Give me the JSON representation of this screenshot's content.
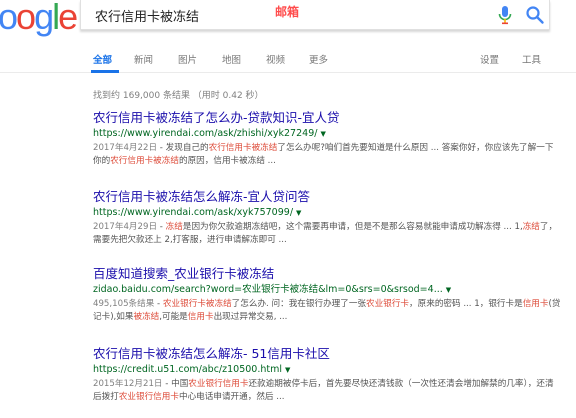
{
  "search": {
    "query": "农行信用卡被冻结",
    "annotation": "邮箱"
  },
  "logo": {
    "letters": [
      "o",
      "o",
      "g",
      "l",
      "e"
    ]
  },
  "tabs": [
    "全部",
    "新闻",
    "图片",
    "地图",
    "视频",
    "更多",
    "设置",
    "工具"
  ],
  "stats": "找到约 169,000 条结果 （用时 0.42 秒）",
  "results": [
    {
      "title": "农行信用卡被冻结了怎么办-贷款知识-宜人贷",
      "url": "https://www.yirendai.com/ask/zhishi/xyk27249/",
      "snippet": [
        {
          "t": "2017年4月22日",
          "c": "d"
        },
        {
          "t": " - 发现自己的"
        },
        {
          "t": "农行信用卡被冻结",
          "c": "hl"
        },
        {
          "t": "了怎么办呢?咱们首先要知道是什么原因 ... 答案你好，你应该先了解一下你的"
        },
        {
          "t": "农行信用卡被冻结",
          "c": "hl"
        },
        {
          "t": "的原因，信用卡被冻结 ..."
        }
      ]
    },
    {
      "title": "农行信用卡被冻结怎么解冻-宜人贷问答",
      "url": "https://www.yirendai.com/ask/xyk757099/",
      "snippet": [
        {
          "t": "2017年4月29日",
          "c": "d"
        },
        {
          "t": " - "
        },
        {
          "t": "冻结",
          "c": "hl"
        },
        {
          "t": "是因为你欠款逾期冻结吧，这个需要再申请，但是不是那么容易就能申请成功解冻得 ... 1,"
        },
        {
          "t": "冻结",
          "c": "hl"
        },
        {
          "t": "了，需要先把欠款还上 2,打客服，进行申请解冻即可 ..."
        }
      ]
    },
    {
      "title": "百度知道搜索_农业银行卡被冻结",
      "url": "zidao.baidu.com/search?word=农业银行卡被冻结&lm=0&srs=0&srsod=4...",
      "snippet": [
        {
          "t": "495,105条结果",
          "c": "d"
        },
        {
          "t": " - "
        },
        {
          "t": "农业银行卡被冻结",
          "c": "hl"
        },
        {
          "t": "了怎么办. 问：我在银行办理了一张"
        },
        {
          "t": "农业银行卡",
          "c": "hl"
        },
        {
          "t": "，原来的密码 ... 1，银行卡是"
        },
        {
          "t": "信用卡",
          "c": "hl"
        },
        {
          "t": "(贷记卡),如果"
        },
        {
          "t": "被冻结",
          "c": "hl"
        },
        {
          "t": ",可能是"
        },
        {
          "t": "信用卡",
          "c": "hl"
        },
        {
          "t": "出现过异常交易, ..."
        }
      ]
    },
    {
      "title": "农行信用卡被冻结怎么解冻- 51信用卡社区",
      "url": "https://credit.u51.com/abc/z10500.html",
      "snippet": [
        {
          "t": "2015年12月21日",
          "c": "d"
        },
        {
          "t": " - 中国"
        },
        {
          "t": "农业银行信用卡",
          "c": "hl"
        },
        {
          "t": "还款逾期被停卡后，首先要尽快还清钱款（一次性还清会增加解禁的几率），还清后拨打"
        },
        {
          "t": "农业银行信用卡",
          "c": "hl"
        },
        {
          "t": "中心电话申请开通，然后 ..."
        }
      ]
    }
  ],
  "colors": {
    "logo": [
      "#4285f4",
      "#ea4335",
      "#4285f4",
      "#34a853",
      "#ea4335"
    ],
    "link": "#1a0dab",
    "url": "#006621",
    "accent": "#1a73e8",
    "highlight": "#dd4b39"
  },
  "icons": {
    "mic": "mic-icon",
    "search": "search-icon",
    "dropdown": "dropdown-arrow-icon"
  }
}
